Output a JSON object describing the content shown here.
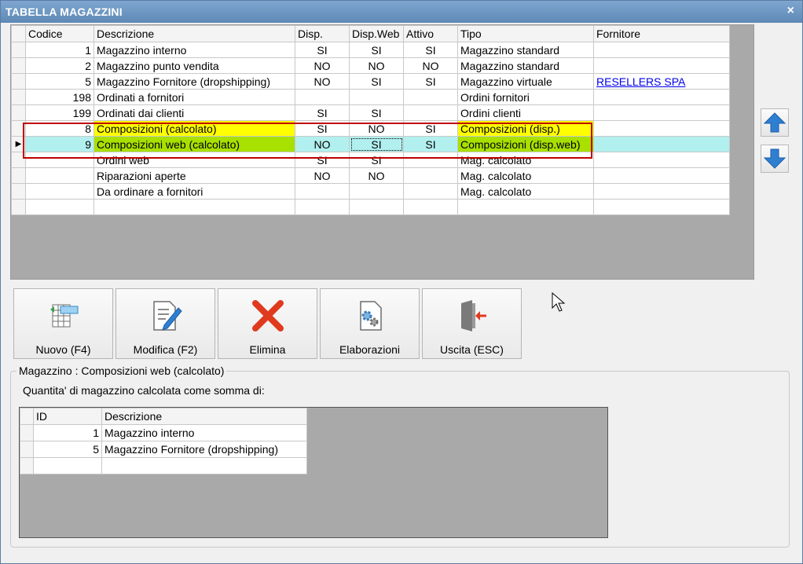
{
  "window": {
    "title": "TABELLA MAGAZZINI",
    "close_glyph": "×"
  },
  "grid": {
    "columns": [
      "Codice",
      "Descrizione",
      "Disp.",
      "Disp.Web",
      "Attivo",
      "Tipo",
      "Fornitore"
    ],
    "rows": [
      {
        "codice": "1",
        "descrizione": "Magazzino interno",
        "disp": "SI",
        "dispweb": "SI",
        "attivo": "SI",
        "tipo": "Magazzino standard",
        "fornitore": ""
      },
      {
        "codice": "2",
        "descrizione": "Magazzino punto vendita",
        "disp": "NO",
        "dispweb": "NO",
        "attivo": "NO",
        "tipo": "Magazzino standard",
        "fornitore": ""
      },
      {
        "codice": "5",
        "descrizione": "Magazzino Fornitore (dropshipping)",
        "disp": "NO",
        "dispweb": "SI",
        "attivo": "SI",
        "tipo": "Magazzino virtuale",
        "fornitore": "RESELLERS SPA"
      },
      {
        "codice": "198",
        "descrizione": "Ordinati a fornitori",
        "disp": "",
        "dispweb": "",
        "attivo": "",
        "tipo": "Ordini fornitori",
        "fornitore": ""
      },
      {
        "codice": "199",
        "descrizione": "Ordinati dai clienti",
        "disp": "SI",
        "dispweb": "SI",
        "attivo": "",
        "tipo": "Ordini clienti",
        "fornitore": ""
      },
      {
        "codice": "8",
        "descrizione": "Composizioni (calcolato)",
        "disp": "SI",
        "dispweb": "NO",
        "attivo": "SI",
        "tipo": "Composizioni (disp.)",
        "fornitore": ""
      },
      {
        "codice": "9",
        "descrizione": "Composizioni web (calcolato)",
        "disp": "NO",
        "dispweb": "SI",
        "attivo": "SI",
        "tipo": "Composizioni (disp.web)",
        "fornitore": ""
      },
      {
        "codice": "",
        "descrizione": "Ordini web",
        "disp": "SI",
        "dispweb": "SI",
        "attivo": "",
        "tipo": "Mag. calcolato",
        "fornitore": ""
      },
      {
        "codice": "",
        "descrizione": "Riparazioni aperte",
        "disp": "NO",
        "dispweb": "NO",
        "attivo": "",
        "tipo": "Mag. calcolato",
        "fornitore": ""
      },
      {
        "codice": "",
        "descrizione": "Da ordinare a fornitori",
        "disp": "",
        "dispweb": "",
        "attivo": "",
        "tipo": "Mag. calcolato",
        "fornitore": ""
      },
      {
        "codice": "",
        "descrizione": "",
        "disp": "",
        "dispweb": "",
        "attivo": "",
        "tipo": "",
        "fornitore": ""
      }
    ],
    "current_row_marker": "▶"
  },
  "side_buttons": {
    "up_icon": "arrow-up-icon",
    "down_icon": "arrow-down-icon"
  },
  "toolbar": {
    "nuovo": "Nuovo (F4)",
    "modifica": "Modifica (F2)",
    "elimina": "Elimina",
    "elaborazioni": "Elaborazioni",
    "uscita": "Uscita (ESC)"
  },
  "detail": {
    "legend": "Magazzino : Composizioni web (calcolato)",
    "subtitle": "Quantita' di magazzino calcolata come somma di:",
    "columns": [
      "ID",
      "Descrizione"
    ],
    "rows": [
      {
        "id": "1",
        "descrizione": "Magazzino interno"
      },
      {
        "id": "5",
        "descrizione": "Magazzino Fornitore (dropshipping)"
      },
      {
        "id": "",
        "descrizione": ""
      }
    ]
  },
  "colors": {
    "title_bar": "#6b95c2",
    "highlight_yellow": "#ffff00",
    "highlight_green": "#a8e000",
    "selected_row": "#b2f0ef",
    "frame_red": "#c00000",
    "arrow_blue": "#2f7fd1"
  }
}
